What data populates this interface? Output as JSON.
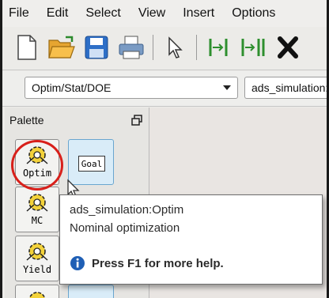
{
  "menu": {
    "items": [
      "File",
      "Edit",
      "Select",
      "View",
      "Insert",
      "Options"
    ]
  },
  "toolbar": {
    "icons": [
      "new-file-icon",
      "open-folder-icon",
      "save-icon",
      "print-icon",
      "pointer-icon",
      "insert-wire-icon",
      "insert-bus-icon",
      "delete-icon"
    ]
  },
  "combos": {
    "library": "Optim/Stat/DOE",
    "component": "ads_simulation:"
  },
  "palette": {
    "title": "Palette",
    "items": [
      {
        "label": "Optim",
        "icon": "optim-gear-icon"
      },
      {
        "label": "Goal",
        "icon": "goal-icon"
      },
      {
        "label": "MC",
        "icon": "mc-gear-icon"
      },
      {
        "label": "Yield",
        "icon": "yield-gear-icon"
      }
    ]
  },
  "tooltip": {
    "title": "ads_simulation:Optim",
    "description": "Nominal optimization",
    "help": "Press F1 for more help."
  },
  "colors": {
    "highlight_ring": "#d8201a",
    "goal_bg": "#d9ecf8",
    "info_blue": "#1f5fb5"
  }
}
